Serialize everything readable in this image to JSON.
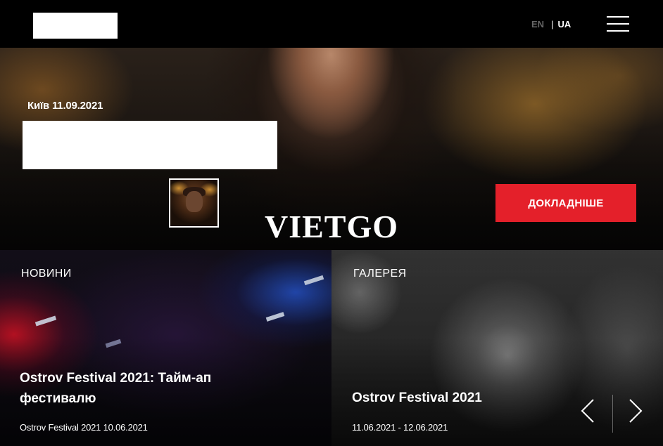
{
  "header": {
    "lang_en": "EN",
    "lang_separator": "|",
    "lang_ua": "UA"
  },
  "hero": {
    "date": "Київ 11.09.2021",
    "cta_label": "ДОКЛАДНІШЕ",
    "watermark": "VIETGO"
  },
  "news": {
    "label": "НОВИНИ",
    "title": "Ostrov Festival 2021: Тайм-ап фестивалю",
    "meta": "Ostrov Festival 2021 10.06.2021"
  },
  "gallery": {
    "label": "ГАЛЕРЕЯ",
    "title": "Ostrov Festival 2021",
    "meta": "11.06.2021 - 12.06.2021"
  },
  "colors": {
    "accent": "#e4202a",
    "background": "#000000"
  },
  "icons": {
    "menu": "hamburger-menu-icon",
    "prev": "chevron-left-icon",
    "next": "chevron-right-icon"
  }
}
